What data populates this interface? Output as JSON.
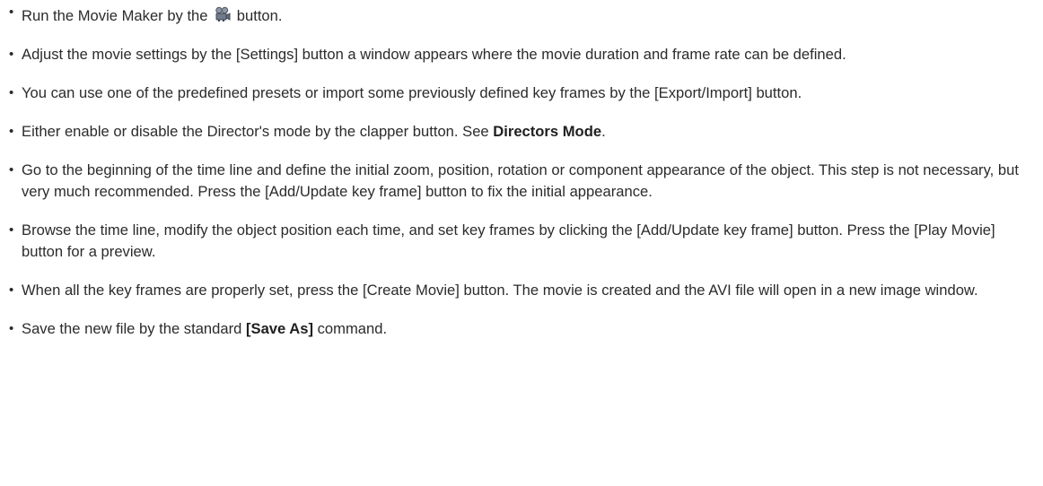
{
  "doc": {
    "steps": [
      {
        "text_before": "Run the Movie Maker by the ",
        "icon": "movie-camera-icon",
        "text_after": " button."
      },
      {
        "text": "Adjust the movie settings by the [Settings] button a window appears where the movie duration and frame rate can be defined."
      },
      {
        "text": "You can use one of the predefined presets or import some previously defined key frames by the [Export/Import] button."
      },
      {
        "text_before": "Either enable or disable the Director's mode by the clapper button. See ",
        "link": "Directors Mode",
        "text_after": "."
      },
      {
        "text": "Go to the beginning of the time line and define the initial zoom, position, rotation or component appearance of the object. This step is not necessary, but very much recommended. Press the [Add/Update key frame] button to fix the initial appearance."
      },
      {
        "text": "Browse the time line, modify the object position each time, and set key frames by clicking the [Add/Update key frame] button. Press the [Play Movie] button for a preview."
      },
      {
        "text": "When all the key frames are properly set, press the [Create Movie] button. The movie is created and the AVI file will open in a new image window."
      },
      {
        "text_before": "Save the new file by the standard ",
        "bold": "[Save As]",
        "text_after": " command."
      }
    ]
  }
}
